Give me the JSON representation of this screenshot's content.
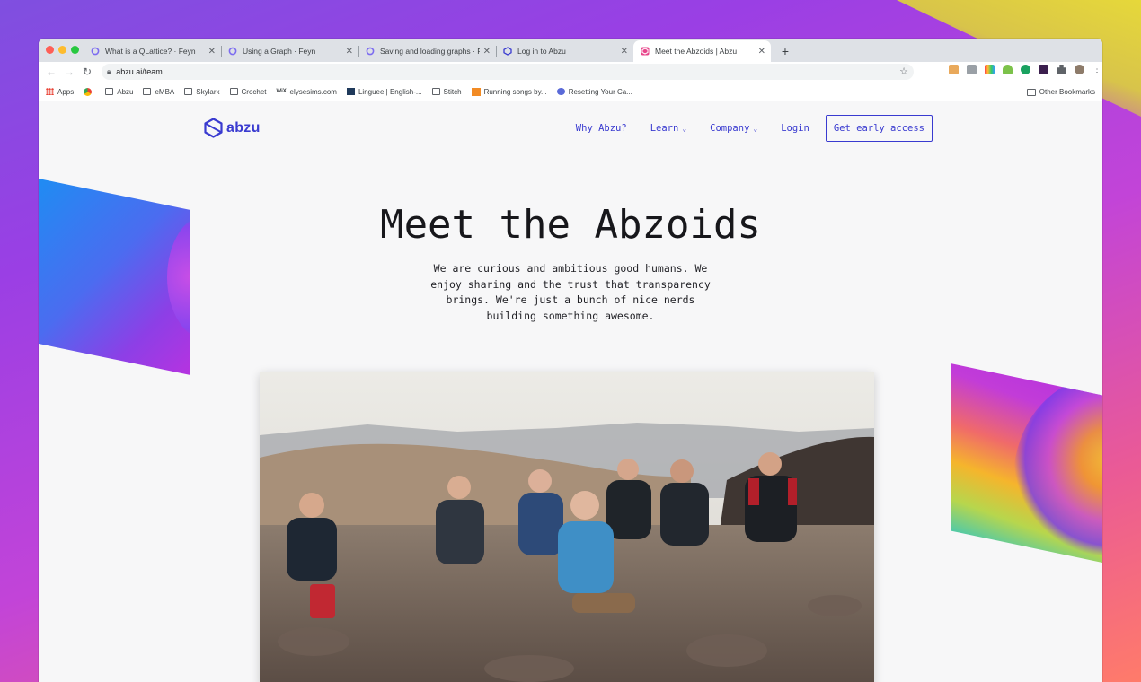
{
  "browser": {
    "tabs": [
      {
        "title": "What is a QLattice? · Feyn",
        "favicon": "feyn-icon"
      },
      {
        "title": "Using a Graph · Feyn",
        "favicon": "feyn-icon"
      },
      {
        "title": "Saving and loading graphs · Fe",
        "favicon": "feyn-icon"
      },
      {
        "title": "Log in to Abzu",
        "favicon": "abzu-icon"
      },
      {
        "title": "Meet the Abzoids | Abzu",
        "favicon": "abzu-icon",
        "active": true
      }
    ],
    "url": "abzu.ai/team",
    "bookmarks": [
      {
        "label": "Apps",
        "icon": "apps-grid-icon"
      },
      {
        "label": "",
        "icon": "chrome-icon"
      },
      {
        "label": "Abzu",
        "icon": "folder-icon"
      },
      {
        "label": "eMBA",
        "icon": "folder-icon"
      },
      {
        "label": "Skylark",
        "icon": "folder-icon"
      },
      {
        "label": "Crochet",
        "icon": "folder-icon"
      },
      {
        "label": "elysesims.com",
        "icon": "wix-icon"
      },
      {
        "label": "Linguee | English-...",
        "icon": "linguee-icon"
      },
      {
        "label": "Stitch",
        "icon": "folder-icon"
      },
      {
        "label": "Running songs by...",
        "icon": "play-icon"
      },
      {
        "label": "Resetting Your Ca...",
        "icon": "link-icon"
      }
    ],
    "other_bookmarks": "Other Bookmarks"
  },
  "site": {
    "logo_text": "abzu",
    "nav": {
      "why": "Why Abzu?",
      "learn": "Learn",
      "company": "Company",
      "login": "Login",
      "cta": "Get early access"
    },
    "hero": {
      "title": "Meet the Abzoids",
      "subtitle": "We are curious and ambitious good humans. We enjoy sharing and the trust that transparency brings. We're just a bunch of nice nerds building something awesome."
    }
  },
  "colors": {
    "brand": "#3a3bd0",
    "page_bg": "#f7f7f8"
  }
}
